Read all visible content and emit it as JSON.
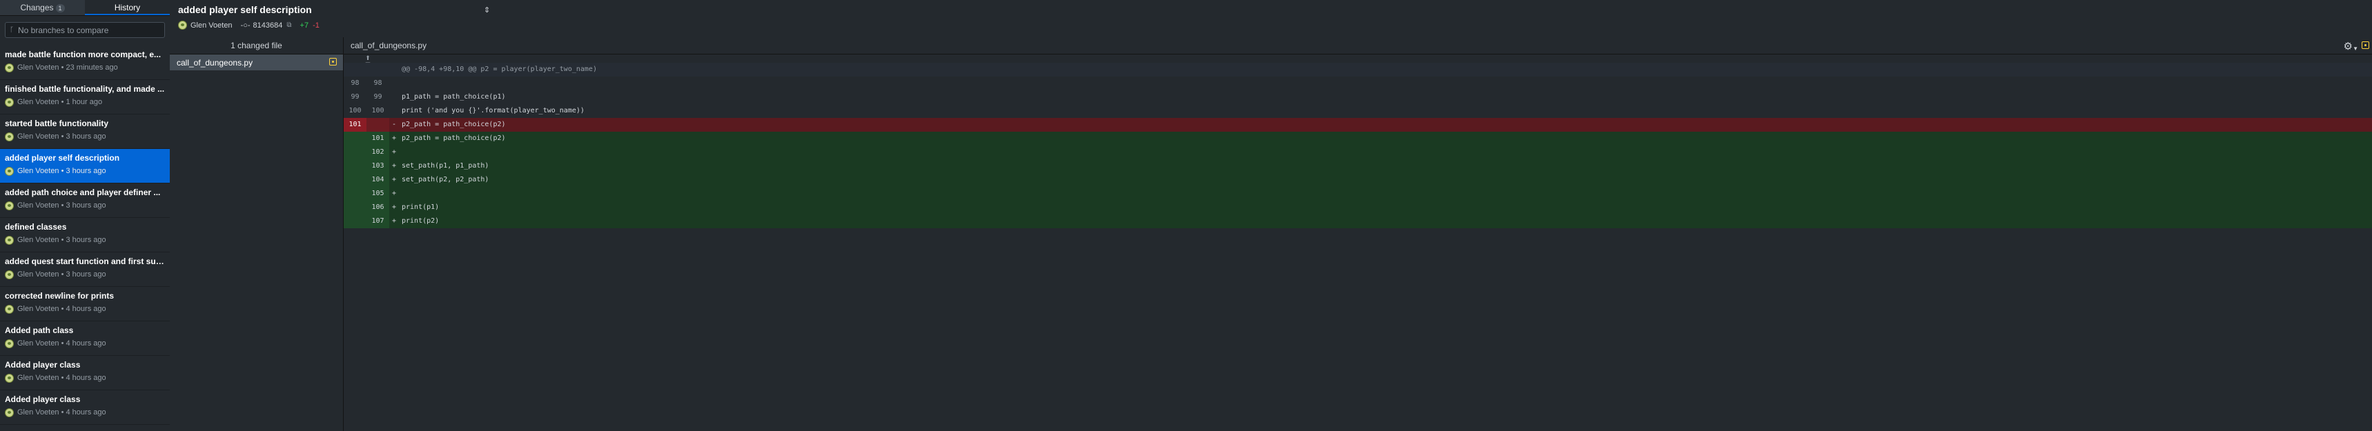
{
  "tabs": {
    "changes_label": "Changes",
    "changes_count": "1",
    "history_label": "History"
  },
  "branch_filter": {
    "placeholder": "No branches to compare"
  },
  "commits": [
    {
      "summary": "made battle function more compact, e...",
      "meta": "Glen Voeten • 23 minutes ago"
    },
    {
      "summary": "finished battle functionality, and made ...",
      "meta": "Glen Voeten • 1 hour ago"
    },
    {
      "summary": "started battle functionality",
      "meta": "Glen Voeten • 3 hours ago"
    },
    {
      "summary": "added player self description",
      "meta": "Glen Voeten • 3 hours ago"
    },
    {
      "summary": "added path choice and player definer ...",
      "meta": "Glen Voeten • 3 hours ago"
    },
    {
      "summary": "defined classes",
      "meta": "Glen Voeten • 3 hours ago"
    },
    {
      "summary": "added quest start function and first suc...",
      "meta": "Glen Voeten • 3 hours ago"
    },
    {
      "summary": "corrected newline for prints",
      "meta": "Glen Voeten • 4 hours ago"
    },
    {
      "summary": "Added path class",
      "meta": "Glen Voeten • 4 hours ago"
    },
    {
      "summary": "Added player class",
      "meta": "Glen Voeten • 4 hours ago"
    },
    {
      "summary": "Added player class",
      "meta": "Glen Voeten • 4 hours ago"
    }
  ],
  "header": {
    "title": "added player self description",
    "author": "Glen Voeten",
    "sha": "8143684",
    "additions": "+7",
    "deletions": "-1"
  },
  "files": {
    "heading": "1 changed file",
    "items": [
      {
        "name": "call_of_dungeons.py"
      }
    ]
  },
  "diff": {
    "filename": "call_of_dungeons.py",
    "hunk": "@@ -98,4 +98,10 @@ p2 = player(player_two_name)",
    "lines": [
      {
        "o": "98",
        "n": "98",
        "m": "",
        "c": ""
      },
      {
        "o": "99",
        "n": "99",
        "m": "",
        "c": "p1_path = path_choice(p1)"
      },
      {
        "o": "100",
        "n": "100",
        "m": "",
        "c": "print ('and you {}'.format(player_two_name))"
      },
      {
        "o": "101",
        "n": "",
        "m": "-",
        "c": "p2_path = path_choice(p2)"
      },
      {
        "o": "",
        "n": "101",
        "m": "+",
        "c": "p2_path = path_choice(p2)"
      },
      {
        "o": "",
        "n": "102",
        "m": "+",
        "c": ""
      },
      {
        "o": "",
        "n": "103",
        "m": "+",
        "c": "set_path(p1, p1_path)"
      },
      {
        "o": "",
        "n": "104",
        "m": "+",
        "c": "set_path(p2, p2_path)"
      },
      {
        "o": "",
        "n": "105",
        "m": "+",
        "c": ""
      },
      {
        "o": "",
        "n": "106",
        "m": "+",
        "c": "print(p1)"
      },
      {
        "o": "",
        "n": "107",
        "m": "+",
        "c": "print(p2)"
      }
    ]
  }
}
